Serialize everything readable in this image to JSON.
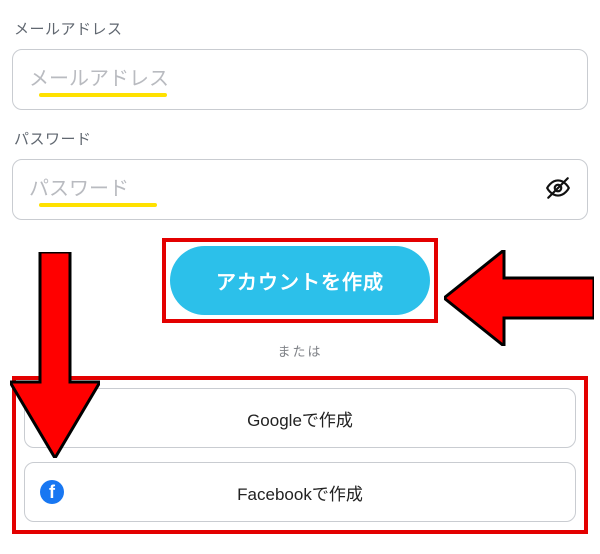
{
  "email": {
    "label": "メールアドレス",
    "placeholder": "メールアドレス"
  },
  "password": {
    "label": "パスワード",
    "placeholder": "パスワード"
  },
  "primary_button": "アカウントを作成",
  "separator": "または",
  "social": {
    "google": "Googleで作成",
    "facebook": "Facebookで作成"
  },
  "colors": {
    "primary": "#2cc0ea",
    "highlight_border": "#e30000",
    "underline": "#ffe100",
    "arrow_fill": "#ff0000",
    "arrow_stroke": "#000000"
  },
  "annotations": {
    "arrow_down": "points to social login buttons",
    "arrow_left": "points to create account button"
  }
}
